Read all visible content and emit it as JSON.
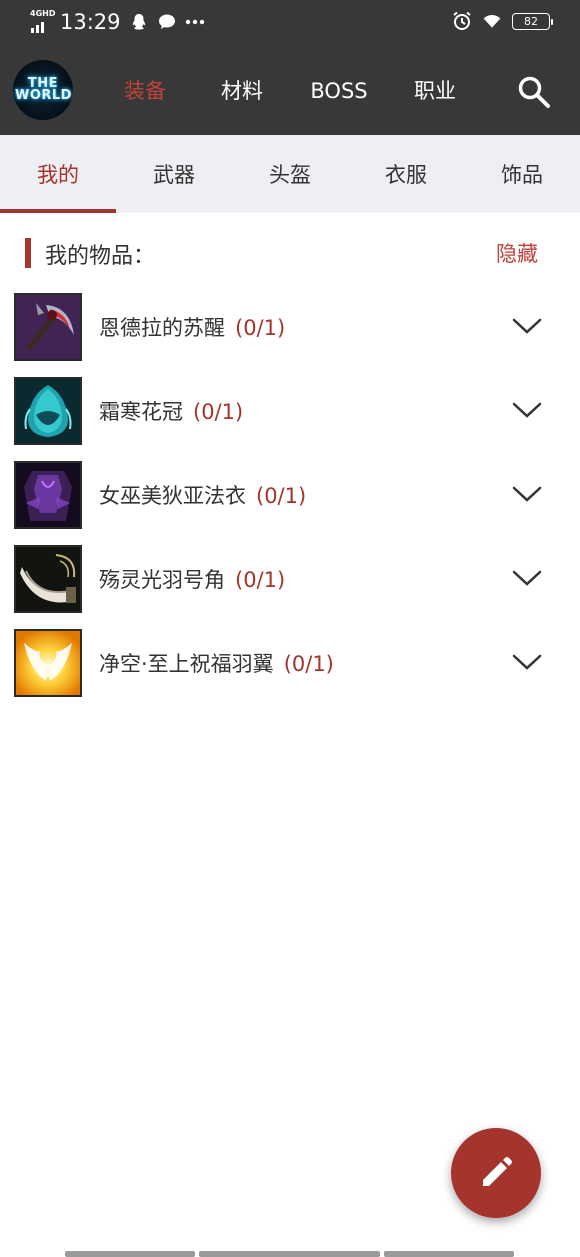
{
  "status_bar": {
    "network": "4GHD",
    "time": "13:29",
    "battery": "82"
  },
  "header": {
    "logo_text": "THE\nWORLD",
    "nav": [
      {
        "label": "装备",
        "active": true
      },
      {
        "label": "材料",
        "active": false
      },
      {
        "label": "BOSS",
        "active": false
      },
      {
        "label": "职业",
        "active": false
      }
    ],
    "search_icon": "search-icon"
  },
  "tabs": [
    {
      "label": "我的",
      "active": true
    },
    {
      "label": "武器",
      "active": false
    },
    {
      "label": "头盔",
      "active": false
    },
    {
      "label": "衣服",
      "active": false
    },
    {
      "label": "饰品",
      "active": false
    }
  ],
  "section": {
    "title": "我的物品：",
    "hide_label": "隐藏"
  },
  "items": [
    {
      "name": "恩德拉的苏醒",
      "count": "(0/1)",
      "icon": "scythe-weapon-icon"
    },
    {
      "name": "霜寒花冠",
      "count": "(0/1)",
      "icon": "frost-helmet-icon"
    },
    {
      "name": "女巫美狄亚法衣",
      "count": "(0/1)",
      "icon": "witch-robe-icon"
    },
    {
      "name": "殇灵光羽号角",
      "count": "(0/1)",
      "icon": "horn-icon"
    },
    {
      "name": "净空·至上祝福羽翼",
      "count": "(0/1)",
      "icon": "golden-wings-icon"
    }
  ],
  "colors": {
    "header_bg": "#383838",
    "accent": "#a4342c",
    "nav_active": "#c0423a",
    "tab_bg": "#efeef3"
  },
  "fab_icon": "edit-pencil-icon"
}
